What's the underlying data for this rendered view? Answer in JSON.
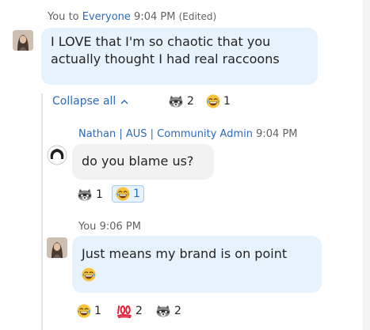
{
  "messages": [
    {
      "sender": "You",
      "to_text": "to",
      "recipient": "Everyone",
      "time": "9:04 PM",
      "edited": "(Edited)",
      "text": "I LOVE that I'm so chaotic that you actually thought I had real raccoons",
      "reactions": [
        {
          "icon": "raccoon-icon",
          "count": "2"
        },
        {
          "icon": "laughing-face-icon",
          "count": "1"
        }
      ]
    },
    {
      "sender": "Nathan | AUS | Community Admin",
      "time": "9:04 PM",
      "text": "do you blame us?",
      "reactions": [
        {
          "icon": "raccoon-icon",
          "count": "1"
        },
        {
          "icon": "laughing-face-icon",
          "count": "1",
          "selected": true
        }
      ]
    },
    {
      "sender": "You",
      "time": "9:06 PM",
      "text": "Just means my brand is on point",
      "reactions": [
        {
          "icon": "laughing-face-icon",
          "count": "1"
        },
        {
          "icon": "hundred-points-icon",
          "count": "2"
        },
        {
          "icon": "raccoon-icon",
          "count": "2"
        }
      ]
    }
  ],
  "thread": {
    "collapse_label": "Collapse all",
    "chevron_icon": "chevron-up-icon"
  },
  "colors": {
    "accent": "#2f6ab8",
    "own_bubble": "#e6f3fd",
    "other_bubble": "#f2f2f2"
  }
}
